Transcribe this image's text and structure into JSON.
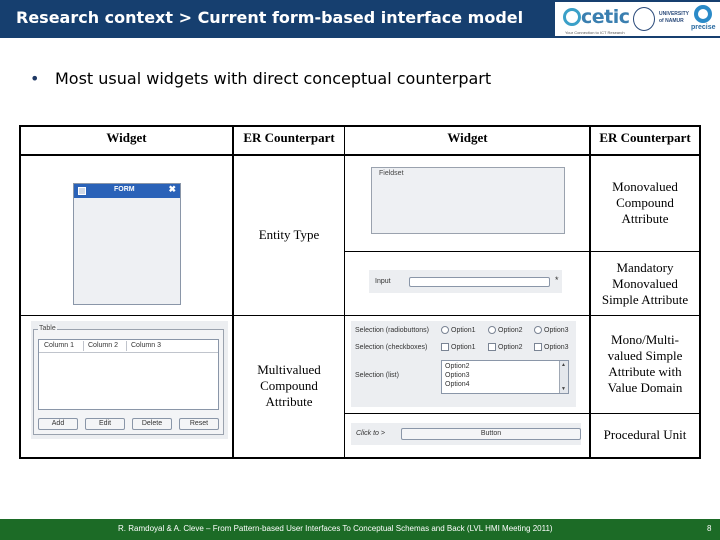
{
  "header": {
    "title": "Research context > Current form-based interface model",
    "logos": {
      "cetic": "cetic",
      "cetic_tagline": "Your Connection to ICT Research",
      "university": "UNIVERSITY of NAMUR",
      "precise": "precise"
    }
  },
  "bullet": {
    "marker": "•",
    "text": "Most usual widgets with direct conceptual counterpart"
  },
  "table": {
    "headers": [
      "Widget",
      "ER Counterpart",
      "Widget",
      "ER Counterpart"
    ],
    "rows_left": [
      {
        "er": "Entity Type"
      },
      {
        "er_lines": [
          "Multivalued",
          "Compound",
          "Attribute"
        ]
      }
    ],
    "rows_right": [
      {
        "er_lines": [
          "Monovalued",
          "Compound",
          "Attribute"
        ]
      },
      {
        "er_lines": [
          "Mandatory",
          "Monovalued",
          "Simple Attribute"
        ]
      },
      {
        "er_lines": [
          "Mono/Multi-",
          "valued Simple",
          "Attribute with",
          "Value Domain"
        ]
      },
      {
        "er": "Procedural Unit"
      }
    ]
  },
  "widgets": {
    "form": {
      "title": "FORM",
      "close": "✖"
    },
    "fieldset_label": "Fieldset",
    "input": {
      "label": "Input",
      "required": "*"
    },
    "table_widget": {
      "legend": "Table",
      "columns": [
        "Column 1",
        "Column 2",
        "Column 3"
      ],
      "buttons": [
        "Add",
        "Edit",
        "Delete",
        "Reset"
      ]
    },
    "selection": {
      "radio_label": "Selection (radiobuttons)",
      "check_label": "Selection (checkboxes)",
      "list_label": "Selection (list)",
      "options": [
        "Option1",
        "Option2",
        "Option3"
      ],
      "list_items": [
        "Option2",
        "Option3",
        "Option4"
      ]
    },
    "button_row": {
      "label": "Click to >",
      "button": "Button"
    }
  },
  "footer": {
    "text": "R. Ramdoyal & A. Cleve – From Pattern-based User Interfaces To Conceptual Schemas and Back (LVL HMI Meeting 2011)",
    "page": "8"
  },
  "colors": {
    "header_bg": "#163f6f",
    "footer_bg": "#1c6b26",
    "accent": "#2a62b8"
  }
}
